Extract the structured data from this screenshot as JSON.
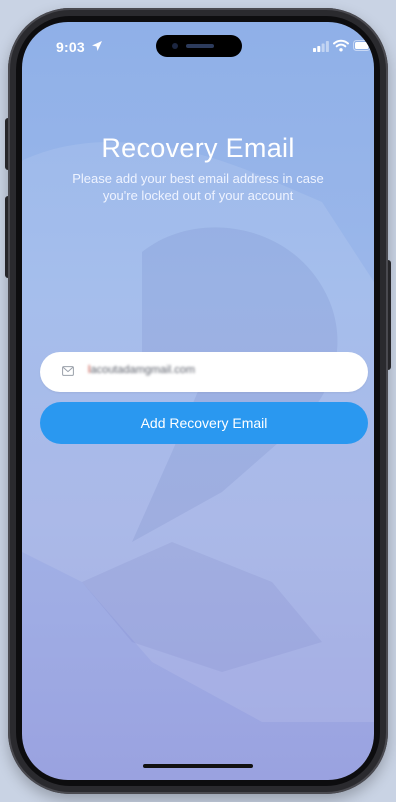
{
  "status_bar": {
    "time": "9:03",
    "icons": [
      "location-arrow-icon",
      "cellular-signal-icon",
      "wifi-icon",
      "battery-icon"
    ]
  },
  "recovery": {
    "title": "Recovery Email",
    "subtitle": "Please add your best email address in case you're locked out of your account",
    "email_value": "lacoutadamgmail.com",
    "submit_label": "Add Recovery Email"
  },
  "colors": {
    "accent": "#2a98f0",
    "background_top": "#8fb0e8",
    "background_bottom": "#9aa2e0",
    "frame": "#2a2a2e"
  }
}
